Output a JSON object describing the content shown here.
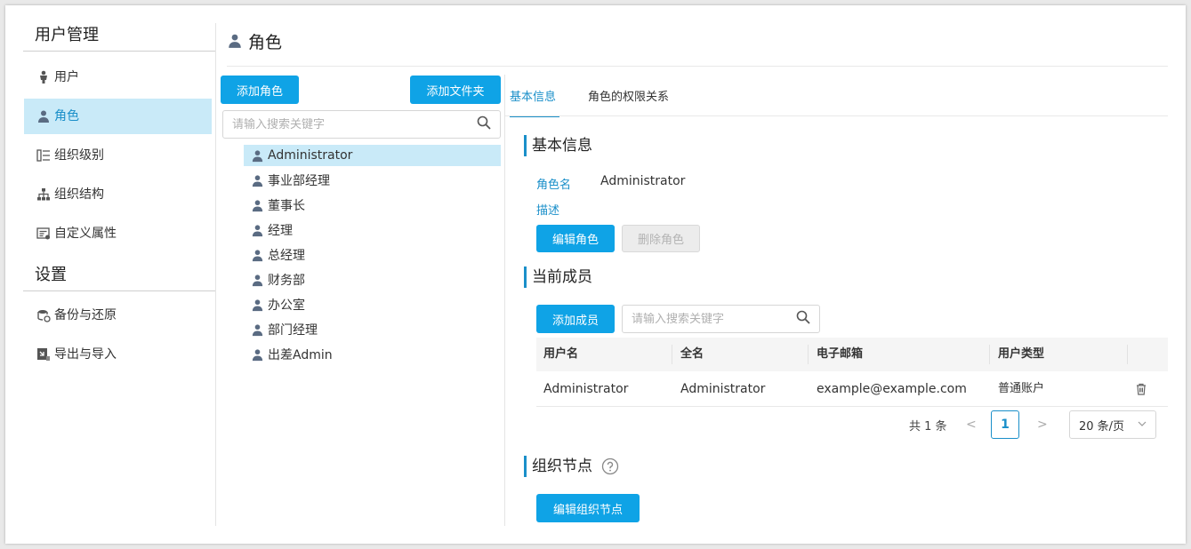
{
  "colors": {
    "accent": "#0fa3e6",
    "active_bg": "#c9eaf8",
    "link": "#1a8fc9"
  },
  "sidebar": {
    "section1_title": "用户管理",
    "section2_title": "设置",
    "items": [
      {
        "label": "用户",
        "icon": "user-standing-icon"
      },
      {
        "label": "角色",
        "icon": "role-person-icon"
      },
      {
        "label": "组织级别",
        "icon": "org-level-icon"
      },
      {
        "label": "组织结构",
        "icon": "org-chart-icon"
      },
      {
        "label": "自定义属性",
        "icon": "custom-attribute-icon"
      },
      {
        "label": "备份与还原",
        "icon": "backup-restore-icon"
      },
      {
        "label": "导出与导入",
        "icon": "export-import-icon"
      }
    ]
  },
  "header": {
    "title": "角色",
    "icon": "role-person-icon"
  },
  "role_panel": {
    "add_role_label": "添加角色",
    "add_folder_label": "添加文件夹",
    "search_placeholder": "请输入搜索关键字",
    "roles": [
      "Administrator",
      "事业部经理",
      "董事长",
      "经理",
      "总经理",
      "财务部",
      "办公室",
      "部门经理",
      "出差Admin"
    ]
  },
  "tabs": {
    "basic": "基本信息",
    "permissions": "角色的权限关系"
  },
  "basic_info": {
    "title": "基本信息",
    "role_name_label": "角色名",
    "role_name_value": "Administrator",
    "description_label": "描述",
    "edit_label": "编辑角色",
    "delete_label": "删除角色"
  },
  "members": {
    "title": "当前成员",
    "add_label": "添加成员",
    "search_placeholder": "请输入搜索关键字",
    "columns": [
      "用户名",
      "全名",
      "电子邮箱",
      "用户类型"
    ],
    "rows": [
      {
        "username": "Administrator",
        "fullname": "Administrator",
        "email": "example@example.com",
        "type": "普通账户"
      }
    ],
    "pagination": {
      "total_text": "共 1 条",
      "current_page": "1",
      "page_size": "20 条/页"
    }
  },
  "org_nodes": {
    "title": "组织节点",
    "edit_label": "编辑组织节点"
  }
}
